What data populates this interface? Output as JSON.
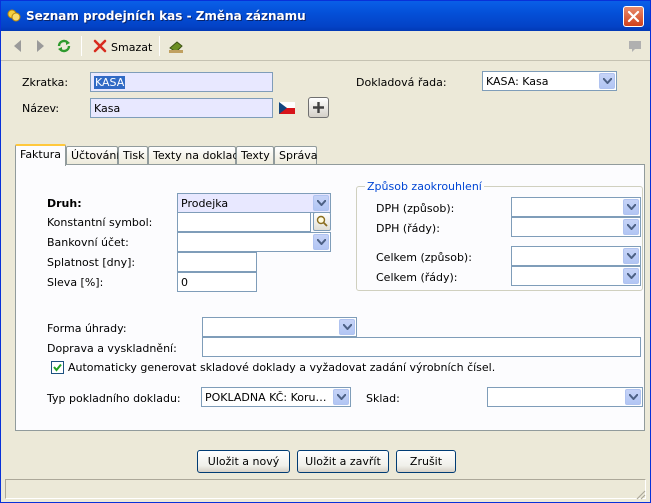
{
  "window": {
    "title": "Seznam prodejních kas - Změna záznamu"
  },
  "toolbar": {
    "delete_label": "Smazat"
  },
  "header": {
    "zkratka_label": "Zkratka:",
    "zkratka_value": "KASA",
    "nazev_label": "Název:",
    "nazev_value": "Kasa",
    "dokladova_rada_label": "Dokladová řada:",
    "dokladova_rada_value": "KASA: Kasa"
  },
  "tabs": [
    {
      "label": "Faktura"
    },
    {
      "label": "Účtování"
    },
    {
      "label": "Tisk"
    },
    {
      "label": "Texty na doklad"
    },
    {
      "label": "Texty"
    },
    {
      "label": "Správa"
    }
  ],
  "form": {
    "druh_label": "Druh:",
    "druh_value": "Prodejka",
    "konst_symbol_label": "Konstantní symbol:",
    "konst_symbol_value": "",
    "bank_ucet_label": "Bankovní účet:",
    "bank_ucet_value": "",
    "splatnost_label": "Splatnost [dny]:",
    "splatnost_value": "",
    "sleva_label": "Sleva [%]:",
    "sleva_value": "0",
    "zaokrouhleni_title": "Způsob zaokrouhlení",
    "dph_zpusob_label": "DPH (způsob):",
    "dph_rady_label": "DPH (řády):",
    "celkem_zpusob_label": "Celkem (způsob):",
    "celkem_rady_label": "Celkem (řády):",
    "forma_uhrady_label": "Forma úhrady:",
    "forma_uhrady_value": "",
    "doprava_label": "Doprava a vyskladnění:",
    "doprava_value": "",
    "auto_checkbox_label": "Automaticky generovat skladové doklady a vyžadovat zadání výrobních čísel.",
    "auto_checkbox_checked": true,
    "typ_dokladu_label": "Typ pokladního dokladu:",
    "typ_dokladu_value": "POKLADNA KČ: Koruno...",
    "sklad_label": "Sklad:",
    "sklad_value": ""
  },
  "buttons": {
    "save_new": "Uložit a nový",
    "save_close": "Uložit a zavřít",
    "cancel": "Zrušit"
  },
  "colors": {
    "title_bar": "#0450d8",
    "tab_highlight": "#ffc83c",
    "group_title": "#0046d5",
    "input_highlight": "#e8e8ff"
  }
}
